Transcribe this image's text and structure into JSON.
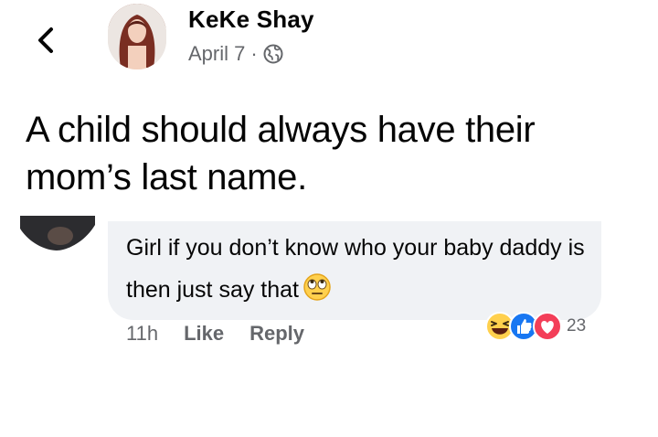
{
  "post": {
    "author": "KeKe Shay",
    "date": "April 7",
    "separator": "·",
    "privacy_icon": "globe-icon",
    "text": "A child should always have their mom’s last name."
  },
  "comment": {
    "text": "Girl if you don’t know who your baby daddy is then just say that",
    "emoji": "face-with-rolling-eyes",
    "time": "11h",
    "like_label": "Like",
    "reply_label": "Reply",
    "reactions": [
      "laughing-emoji-icon",
      "like-reaction-icon",
      "love-reaction-icon"
    ],
    "reaction_count": "23"
  },
  "colors": {
    "bubble": "#f0f2f5",
    "secondary_text": "#65676b",
    "like_blue": "#1877f2",
    "love_red": "#f33e58"
  }
}
